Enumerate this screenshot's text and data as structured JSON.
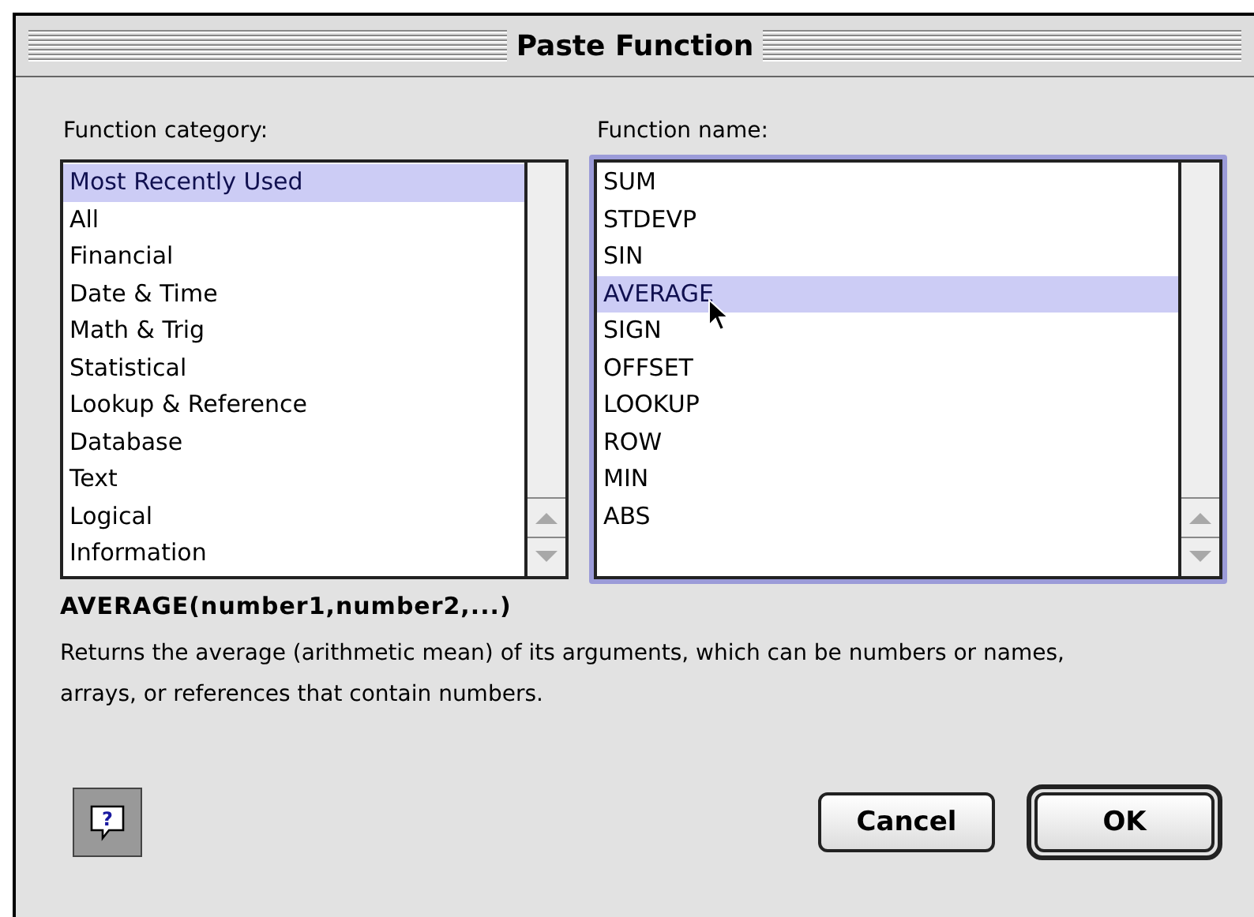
{
  "window": {
    "title": "Paste Function"
  },
  "category_list": {
    "label": "Function category:",
    "items": [
      {
        "label": "Most Recently Used",
        "selected": true
      },
      {
        "label": "All",
        "selected": false
      },
      {
        "label": "Financial",
        "selected": false
      },
      {
        "label": "Date & Time",
        "selected": false
      },
      {
        "label": "Math & Trig",
        "selected": false
      },
      {
        "label": "Statistical",
        "selected": false
      },
      {
        "label": "Lookup & Reference",
        "selected": false
      },
      {
        "label": "Database",
        "selected": false
      },
      {
        "label": "Text",
        "selected": false
      },
      {
        "label": "Logical",
        "selected": false
      },
      {
        "label": "Information",
        "selected": false
      }
    ]
  },
  "function_list": {
    "label": "Function name:",
    "focused": true,
    "items": [
      {
        "label": "SUM",
        "selected": false
      },
      {
        "label": "STDEVP",
        "selected": false
      },
      {
        "label": "SIN",
        "selected": false
      },
      {
        "label": "AVERAGE",
        "selected": true
      },
      {
        "label": "SIGN",
        "selected": false
      },
      {
        "label": "OFFSET",
        "selected": false
      },
      {
        "label": "LOOKUP",
        "selected": false
      },
      {
        "label": "ROW",
        "selected": false
      },
      {
        "label": "MIN",
        "selected": false
      },
      {
        "label": "ABS",
        "selected": false
      }
    ]
  },
  "help_button": {
    "label": "?"
  },
  "syntax": "AVERAGE(number1,number2,...)",
  "description": "Returns the average (arithmetic mean) of its arguments, which can be numbers or names, arrays, or references that contain numbers.",
  "buttons": [
    {
      "label": "Cancel",
      "default": false
    },
    {
      "label": "OK",
      "default": true
    }
  ]
}
